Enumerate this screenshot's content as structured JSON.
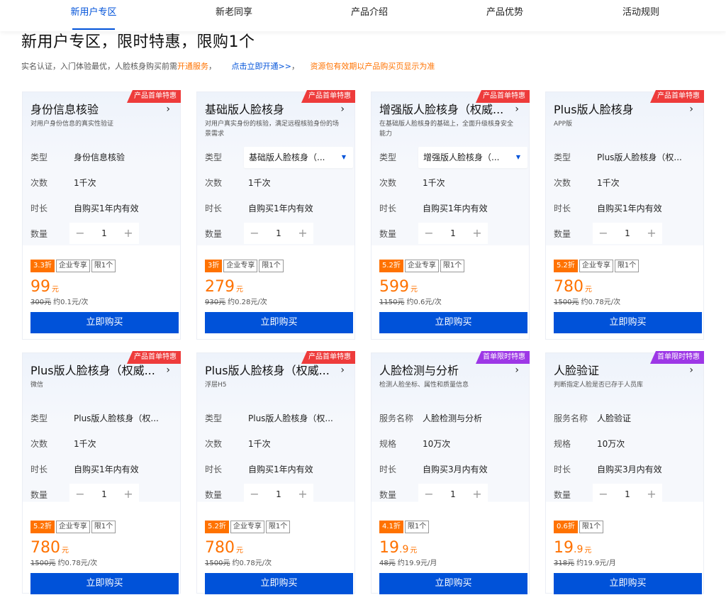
{
  "nav": {
    "tabs": [
      "新用户专区",
      "新老同享",
      "产品介绍",
      "产品优势",
      "活动规则"
    ]
  },
  "header": {
    "title": "新用户专区，限时特惠，限购1个",
    "sub_a": "实名认证，入门体验最优，人脸核身购买前需",
    "sub_b": "开通服务",
    "sub_c": "，",
    "sub_d": "点击立即开通>>",
    "sub_e": "，",
    "sub_f": "资源包有效期以产品购买页显示为准"
  },
  "buy_label": "立即购买",
  "cards": [
    {
      "badge": "产品首单特惠",
      "badge_color": "#ee3b3b",
      "title": "身份信息核验",
      "desc": "对用户身份信息的真实性验证",
      "r1_label": "类型",
      "r1_value": "身份信息核验",
      "r2_label": "次数",
      "r2_value": "1千次",
      "r3_label": "时长",
      "r3_value": "自购买1年内有效",
      "qty_label": "数量",
      "qty": "1",
      "discount": "3.3折",
      "tag_a": "企业专享",
      "tag_b": "限1个",
      "price": "99",
      "unit": "元",
      "orig": "300元",
      "per": "约0.1元/次"
    },
    {
      "badge": "产品首单特惠",
      "badge_color": "#ee3b3b",
      "title": "基础版人脸核身",
      "desc": "对用户真实身份的核验，满足远程核验身份的场景需求",
      "r1_label": "类型",
      "r1_value": "基础版人脸核身（...",
      "r2_label": "次数",
      "r2_value": "1千次",
      "r3_label": "时长",
      "r3_value": "自购买1年内有效",
      "qty_label": "数量",
      "qty": "1",
      "discount": "3折",
      "tag_a": "企业专享",
      "tag_b": "限1个",
      "price": "279",
      "unit": "元",
      "orig": "930元",
      "per": "约0.28元/次"
    },
    {
      "badge": "产品首单特惠",
      "badge_color": "#ee3b3b",
      "title": "增强版人脸核身（权威...",
      "desc": "在基础版人脸核身的基础上，全面升级核身安全能力",
      "r1_label": "类型",
      "r1_value": "增强版人脸核身（...",
      "r2_label": "次数",
      "r2_value": "1千次",
      "r3_label": "时长",
      "r3_value": "自购买1年内有效",
      "qty_label": "数量",
      "qty": "1",
      "discount": "5.2折",
      "tag_a": "企业专享",
      "tag_b": "限1个",
      "price": "599",
      "unit": "元",
      "orig": "1150元",
      "per": "约0.6元/次"
    },
    {
      "badge": "产品首单特惠",
      "badge_color": "#ee3b3b",
      "title": "Plus版人脸核身",
      "desc": "APP版",
      "r1_label": "类型",
      "r1_value": "Plus版人脸核身（权...",
      "r2_label": "次数",
      "r2_value": "1千次",
      "r3_label": "时长",
      "r3_value": "自购买1年内有效",
      "qty_label": "数量",
      "qty": "1",
      "discount": "5.2折",
      "tag_a": "企业专享",
      "tag_b": "限1个",
      "price": "780",
      "unit": "元",
      "orig": "1500元",
      "per": "约0.78元/次"
    },
    {
      "badge": "产品首单特惠",
      "badge_color": "#ee3b3b",
      "title": "Plus版人脸核身（权威...",
      "desc": "微信",
      "r1_label": "类型",
      "r1_value": "Plus版人脸核身（权...",
      "r2_label": "次数",
      "r2_value": "1千次",
      "r3_label": "时长",
      "r3_value": "自购买1年内有效",
      "qty_label": "数量",
      "qty": "1",
      "discount": "5.2折",
      "tag_a": "企业专享",
      "tag_b": "限1个",
      "price": "780",
      "unit": "元",
      "orig": "1500元",
      "per": "约0.78元/次"
    },
    {
      "badge": "产品首单特惠",
      "badge_color": "#ee3b3b",
      "title": "Plus版人脸核身（权威...",
      "desc": "浮层H5",
      "r1_label": "类型",
      "r1_value": "Plus版人脸核身（权...",
      "r2_label": "次数",
      "r2_value": "1千次",
      "r3_label": "时长",
      "r3_value": "自购买1年内有效",
      "qty_label": "数量",
      "qty": "1",
      "discount": "5.2折",
      "tag_a": "企业专享",
      "tag_b": "限1个",
      "price": "780",
      "unit": "元",
      "orig": "1500元",
      "per": "约0.78元/次"
    },
    {
      "badge": "首单限时特惠",
      "badge_color": "#9d37e6",
      "title": "人脸检测与分析",
      "desc": "检测人脸坐标、属性和质量信息",
      "r1_label": "服务名称",
      "r1_value": "人脸检测与分析",
      "r2_label": "规格",
      "r2_value": "10万次",
      "r3_label": "时长",
      "r3_value": "自购买3月内有效",
      "qty_label": "数量",
      "qty": "1",
      "discount": "4.1折",
      "tag_a": "",
      "tag_b": "限1个",
      "price": "19",
      "price_dec": ".9",
      "unit": "元",
      "orig": "48元",
      "per": "约19.9元/月"
    },
    {
      "badge": "首单限时特惠",
      "badge_color": "#9d37e6",
      "title": "人脸验证",
      "desc": "判断指定人脸是否已存于人员库",
      "r1_label": "服务名称",
      "r1_value": "人脸验证",
      "r2_label": "规格",
      "r2_value": "10万次",
      "r3_label": "时长",
      "r3_value": "自购买3月内有效",
      "qty_label": "数量",
      "qty": "1",
      "discount": "0.6折",
      "tag_a": "",
      "tag_b": "限1个",
      "price": "19",
      "price_dec": ".9",
      "unit": "元",
      "orig": "318元",
      "per": "约19.9元/月"
    }
  ]
}
